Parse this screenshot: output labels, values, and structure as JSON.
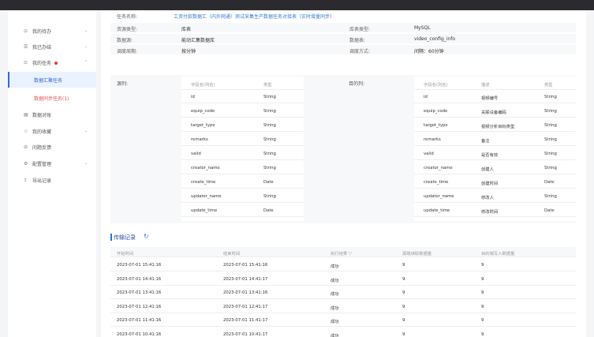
{
  "sidebar": {
    "items": [
      {
        "icon": "⊙",
        "label": "我的待办",
        "caret": "⌄"
      },
      {
        "icon": "☰",
        "label": "我已办结",
        "caret": "⌄"
      },
      {
        "icon": "⊙",
        "label": "我的任务",
        "caret": "⌃",
        "dot": true
      },
      {
        "icon": "",
        "label": "数据汇聚任务",
        "sub": true,
        "active": true
      },
      {
        "icon": "",
        "label": "数据同步任务(1)",
        "sub": true,
        "red": true
      },
      {
        "icon": "▤",
        "label": "数据对账"
      },
      {
        "icon": "☆",
        "label": "我的收藏",
        "caret": "⌄"
      },
      {
        "icon": "⊘",
        "label": "问题反馈"
      },
      {
        "icon": "⚙",
        "label": "配置管理",
        "caret": "⌄"
      },
      {
        "icon": "⇪",
        "label": "导出记录"
      }
    ]
  },
  "task": {
    "name_label": "任务名称:",
    "name_value": "工资付款数据汇（内外网通）测试采集生产数据任务对接表（实时增量同步）"
  },
  "info": {
    "rows": [
      {
        "lk": "资源类型:",
        "lv": "库表",
        "rk": "库表类型:",
        "rv": "MySQL"
      },
      {
        "lk": "数据源:",
        "lv": "能动汇集数据库",
        "rk": "数据表:",
        "rv": "video_config_info"
      },
      {
        "lk": "调度周期:",
        "lv": "按分钟",
        "rk": "调度方式:",
        "rv": "间隔：60分钟"
      }
    ]
  },
  "mapping": {
    "source_title": "源列:",
    "target_title": "目的列:",
    "source_headers": [
      "字段名(列名)",
      "类型"
    ],
    "target_headers": [
      "字段名(列名)",
      "描述",
      "类型"
    ],
    "source_rows": [
      [
        "id",
        "String"
      ],
      [
        "equip_code",
        "String"
      ],
      [
        "target_type",
        "String"
      ],
      [
        "remarks",
        "String"
      ],
      [
        "valid",
        "String"
      ],
      [
        "creator_name",
        "String"
      ],
      [
        "create_time",
        "Date"
      ],
      [
        "updator_name",
        "String"
      ],
      [
        "update_time",
        "Date"
      ]
    ],
    "target_rows": [
      [
        "id",
        "视频编号",
        "String"
      ],
      [
        "equip_code",
        "关联设备编码",
        "String"
      ],
      [
        "target_type",
        "视频分析目标类型",
        "String"
      ],
      [
        "remarks",
        "备注",
        "String"
      ],
      [
        "valid",
        "是否有效",
        "String"
      ],
      [
        "creator_name",
        "创建人",
        "String"
      ],
      [
        "create_time",
        "创建时间",
        "Date"
      ],
      [
        "updator_name",
        "修改人",
        "String"
      ],
      [
        "update_time",
        "修改时间",
        "Date"
      ]
    ]
  },
  "records": {
    "title": "传输记录",
    "refresh_icon": "refresh-icon",
    "headers": [
      "开始时间",
      "结束时间",
      "执行结果 ▽",
      "源端读取数据量",
      "目的端写入数据量"
    ],
    "rows": [
      [
        "2023-07-01 15:41:16",
        "2023-07-01 15:41:16",
        "成功",
        "9",
        "9"
      ],
      [
        "2023-07-01 14:41:16",
        "2023-07-01 14:41:17",
        "成功",
        "9",
        "9"
      ],
      [
        "2023-07-01 13:41:16",
        "2023-07-01 13:41:16",
        "成功",
        "9",
        "9"
      ],
      [
        "2023-07-01 12:41:16",
        "2023-07-01 12:41:17",
        "成功",
        "9",
        "9"
      ],
      [
        "2023-07-01 11:41:16",
        "2023-07-01 11:41:17",
        "成功",
        "9",
        "9"
      ],
      [
        "2023-07-01 10:41:16",
        "2023-07-01 10:41:17",
        "成功",
        "9",
        "9"
      ]
    ]
  }
}
